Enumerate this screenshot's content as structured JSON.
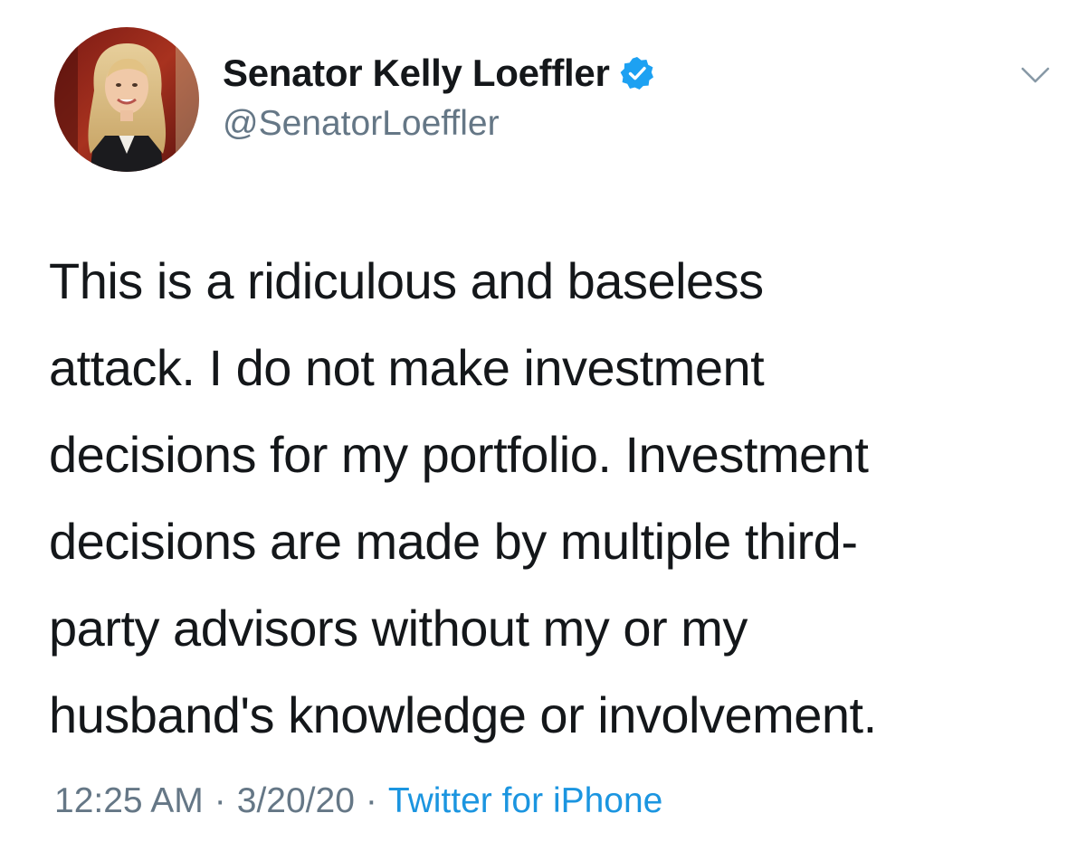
{
  "colors": {
    "name_text": "#14171a",
    "secondary_text": "#657786",
    "link": "#1b95e0",
    "verified_badge": "#1da1f2",
    "background": "#ffffff"
  },
  "author": {
    "display_name": "Senator Kelly Loeffler",
    "handle": "@SenatorLoeffler",
    "verified": true,
    "avatar_icon": "profile-photo"
  },
  "menu": {
    "icon": "chevron-down-icon"
  },
  "tweet": {
    "text": "This is a ridiculous and baseless\nattack. I do not make investment\ndecisions for my portfolio. Investment\ndecisions are made by multiple third-\nparty advisors without my or my\nhusband's knowledge or involvement."
  },
  "meta": {
    "time": "12:25 AM",
    "separator": "·",
    "date": "3/20/20",
    "source": "Twitter for iPhone"
  }
}
